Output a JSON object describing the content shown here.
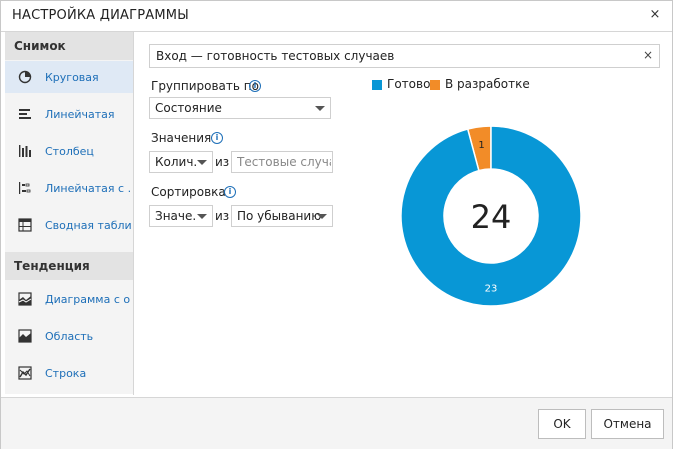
{
  "dialog": {
    "title": "НАСТРОЙКА ДИАГРАММЫ",
    "close_symbol": "×"
  },
  "sidebar": {
    "snapshot_header": "Снимок",
    "snapshot_items": [
      {
        "label": "Круговая",
        "icon": "pie-chart-icon",
        "active": true
      },
      {
        "label": "Линейчатая",
        "icon": "bar-chart-icon",
        "active": false
      },
      {
        "label": "Столбец",
        "icon": "column-chart-icon",
        "active": false
      },
      {
        "label": "Линейчатая с ...",
        "icon": "stacked-bar-chart-icon",
        "active": false
      },
      {
        "label": "Сводная таблица",
        "icon": "pivot-table-icon",
        "active": false
      }
    ],
    "trend_header": "Тенденция",
    "trend_items": [
      {
        "label": "Диаграмма с о...",
        "icon": "stacked-area-chart-icon"
      },
      {
        "label": "Область",
        "icon": "area-chart-icon"
      },
      {
        "label": "Строка",
        "icon": "line-chart-icon"
      }
    ]
  },
  "config": {
    "chart_title_value": "Вход — готовность тестовых случаев",
    "clear_symbol": "×",
    "group_by_label": "Группировать по",
    "group_by_value": "Состояние",
    "values_label": "Значения",
    "aggregation_value": "Колич...",
    "of_word": "из",
    "values_field_placeholder": "Тестовые случаи",
    "sort_label": "Сортировка",
    "sort_field_value": "Значе...",
    "sort_of_word": "из",
    "sort_order_value": "По убыванию",
    "info_symbol": "i"
  },
  "footer": {
    "ok_label": "OK",
    "cancel_label": "Отмена"
  },
  "colors": {
    "ready": "#0897d6",
    "in_development": "#f28c28",
    "accent": "#1e6fb8"
  },
  "chart_data": {
    "type": "pie",
    "variant": "donut",
    "categories": [
      "Готово",
      "В разработке"
    ],
    "values": [
      23,
      1
    ],
    "total": 24,
    "slice_labels": [
      "23",
      "1"
    ],
    "legend_position": "top"
  }
}
